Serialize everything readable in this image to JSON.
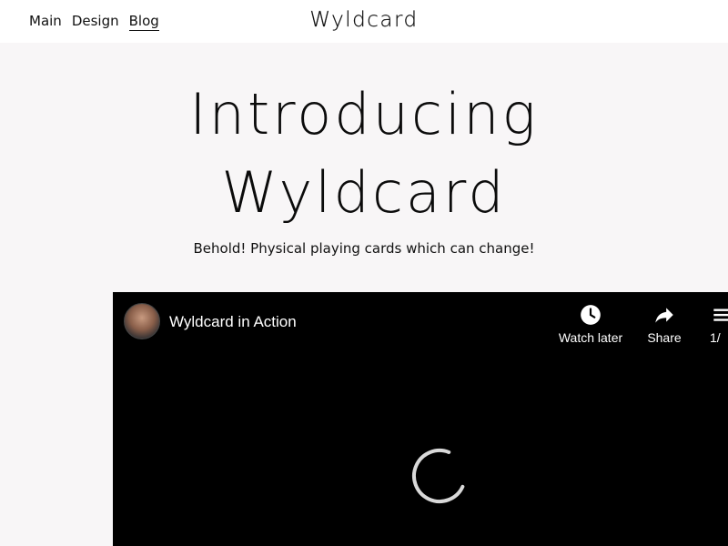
{
  "nav": {
    "items": [
      {
        "label": "Main"
      },
      {
        "label": "Design"
      },
      {
        "label": "Blog",
        "active": true
      }
    ]
  },
  "brand": {
    "name": "Wyldcard"
  },
  "hero": {
    "title_line1": "Introducing",
    "title_line2": "Wyldcard",
    "subtitle": "Behold!  Physical playing cards which can change!"
  },
  "video": {
    "title": "Wyldcard in Action",
    "buttons": {
      "watch_later": "Watch later",
      "share": "Share",
      "playlist": "1/"
    },
    "icons": [
      "avatar",
      "clock-icon",
      "share-arrow-icon",
      "playlist-icon",
      "loading-spinner-icon"
    ]
  },
  "colors": {
    "page_bg": "#f8f6f7",
    "topbar_bg": "#ffffff",
    "video_bg": "#000000",
    "text": "#111111"
  }
}
